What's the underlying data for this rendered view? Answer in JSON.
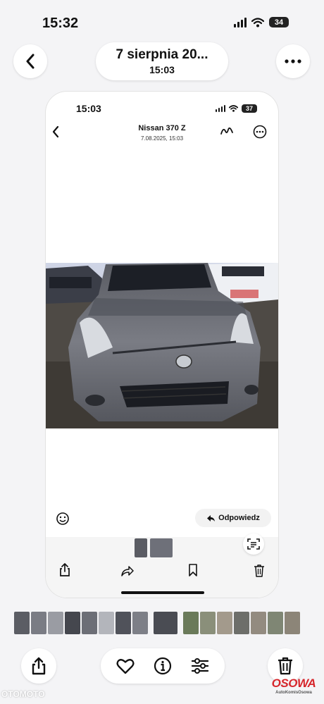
{
  "status_bar": {
    "time": "15:32",
    "battery": "34"
  },
  "header": {
    "title": "7 sierpnia 20...",
    "subtitle": "15:03"
  },
  "inner": {
    "status_time": "15:03",
    "battery": "37",
    "title": "Nissan 370 Z",
    "subtitle": "7.08.2025, 15:03",
    "reply_label": "Odpowiedz"
  },
  "watermark": {
    "brand": "OSOWA",
    "tagline": "AutoKomisOsowa"
  },
  "olx_mark": "OTOMOTO",
  "icons": {
    "back": "chevron-left-icon",
    "more": "ellipsis-icon",
    "share": "share-icon",
    "favorite": "heart-icon",
    "info": "info-icon",
    "adjust": "sliders-icon",
    "delete": "trash-icon"
  },
  "colors": {
    "accent": "#d6262c",
    "background": "#f4f4f6",
    "car": "#6e7079"
  }
}
